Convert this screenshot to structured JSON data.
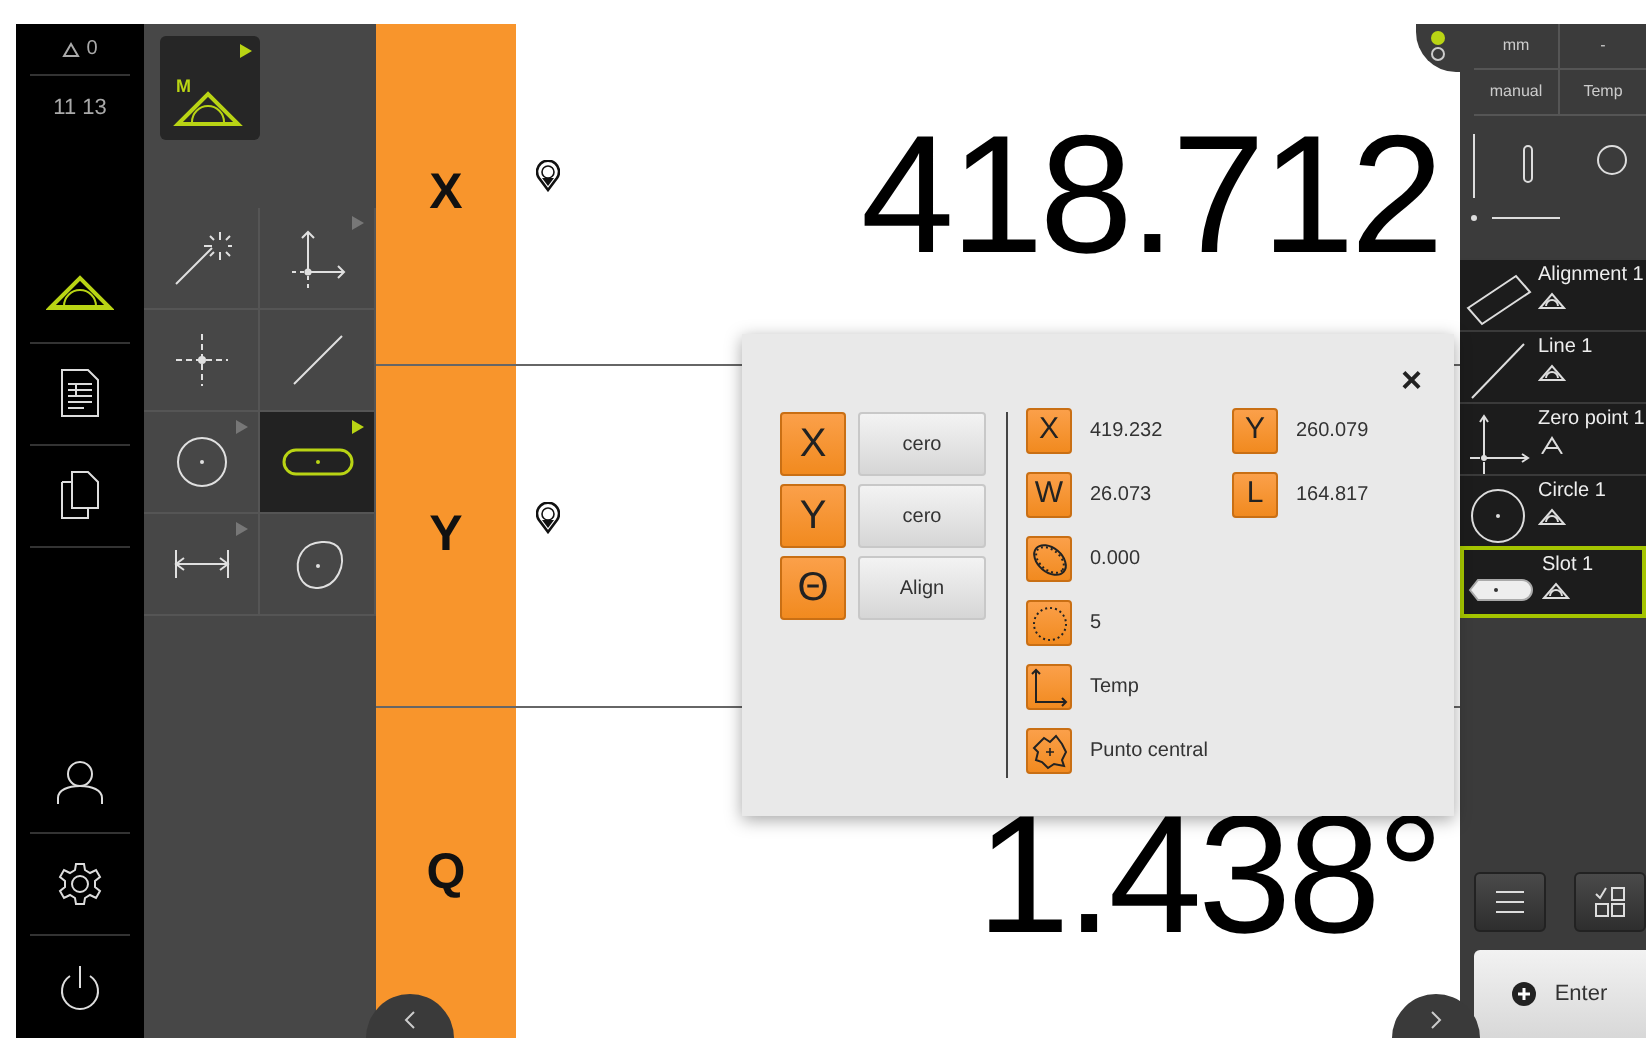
{
  "status": {
    "warnings": "0",
    "time": "11 13"
  },
  "nav": [
    {
      "kind": "measure",
      "selected": true
    },
    {
      "kind": "report",
      "selected": false
    },
    {
      "kind": "files",
      "selected": false
    },
    {
      "kind": "user",
      "selected": false
    },
    {
      "kind": "settings",
      "selected": false
    },
    {
      "kind": "power",
      "selected": false
    }
  ],
  "mode_tile": {
    "label": "M"
  },
  "tools": [
    {
      "kind": "wand",
      "submenu": false,
      "selected": false
    },
    {
      "kind": "zero-point",
      "submenu": true,
      "selected": false
    },
    {
      "kind": "point",
      "submenu": false,
      "selected": false
    },
    {
      "kind": "line",
      "submenu": false,
      "selected": false
    },
    {
      "kind": "circle",
      "submenu": true,
      "selected": false
    },
    {
      "kind": "slot",
      "submenu": true,
      "selected": true
    },
    {
      "kind": "distance",
      "submenu": true,
      "selected": false
    },
    {
      "kind": "blob",
      "submenu": false,
      "selected": false
    }
  ],
  "axes": [
    {
      "label": "X",
      "value": "418.712",
      "reference_mark": true
    },
    {
      "label": "Y",
      "reference_mark": true
    },
    {
      "label": "Q",
      "value": "1.438°",
      "reference_mark": false
    }
  ],
  "dialog": {
    "close": "×",
    "axis_actions": [
      {
        "axis": "X",
        "action": "cero"
      },
      {
        "axis": "Y",
        "action": "cero"
      },
      {
        "axis": "Θ",
        "action": "Align"
      }
    ],
    "results": [
      {
        "kind": "letter",
        "label": "X",
        "value": "419.232"
      },
      {
        "kind": "letter",
        "label": "Y",
        "value": "260.079"
      },
      {
        "kind": "letter",
        "label": "W",
        "value": "26.073"
      },
      {
        "kind": "letter",
        "label": "L",
        "value": "164.817"
      },
      {
        "kind": "ellipse",
        "value": "0.000"
      },
      {
        "kind": "circle",
        "value": "5"
      },
      {
        "kind": "axes",
        "value": "Temp"
      },
      {
        "kind": "blob",
        "value": "Punto central"
      }
    ]
  },
  "settings": [
    "mm",
    "-",
    "manual",
    "Temp"
  ],
  "features": [
    {
      "kind": "alignment",
      "name": "Alignment 1",
      "measured": true,
      "selected": false
    },
    {
      "kind": "line",
      "name": "Line 1",
      "measured": true,
      "selected": false
    },
    {
      "kind": "zero-point",
      "name": "Zero point 1",
      "measured": false,
      "selected": false
    },
    {
      "kind": "circle",
      "name": "Circle 1",
      "measured": true,
      "selected": false
    },
    {
      "kind": "slot",
      "name": "Slot 1",
      "measured": true,
      "selected": true
    }
  ],
  "enter": {
    "label": "Enter"
  }
}
